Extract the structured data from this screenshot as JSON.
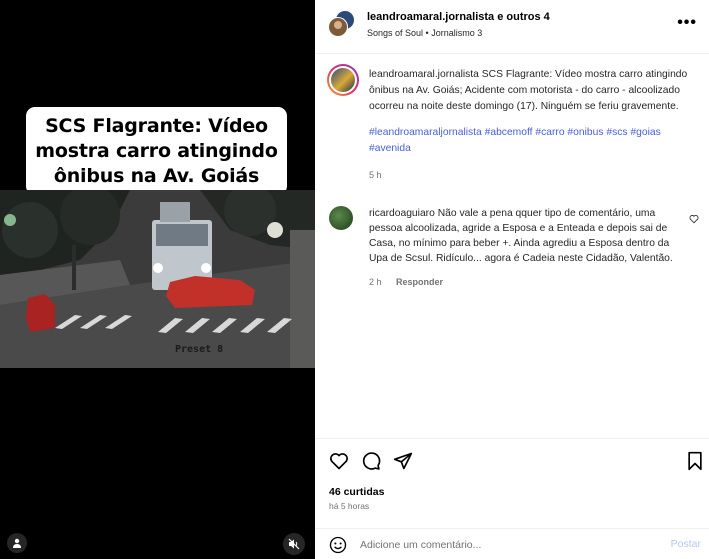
{
  "media": {
    "banner_text": "SCS Flagrante: Vídeo\nmostra carro atingindo\nônibus na Av. Goiás",
    "cctv_label": "Preset 8",
    "user_tag_icon": "user-icon",
    "mute_icon": "speaker-muted-icon"
  },
  "header": {
    "author": "leandroamaral.jornalista e outros 4",
    "subtitle": "Songs of Soul • Jornalismo 3",
    "more_icon": "more-options-icon"
  },
  "caption": {
    "username": "leandroamaral.jornalista",
    "text": "SCS Flagrante: Vídeo mostra carro atingindo ônibus na Av. Goiás; Acidente com motorista - do carro - alcoolizado ocorreu na noite deste domingo (17). Ninguém se feriu gravemente.",
    "hashtags": "#leandroamaraljornalista #abcemoff #carro #onibus #scs #goias #avenida",
    "time": "5 h"
  },
  "comment": {
    "username": "ricardoaguiaro",
    "text": "Não vale a pena qquer tipo de comentário, uma pessoa alcoolizada, agride a Esposa e a Enteada e depois sai de Casa, no mínimo para beber +. Ainda agrediu a Esposa dentro da Upa de Scsul. Ridículo... agora é Cadeia neste Cidadão, Valentão.",
    "time": "2 h",
    "reply_label": "Responder"
  },
  "actions": {
    "likes": "46 curtidas",
    "time_ago": "há 5 horas"
  },
  "add_comment": {
    "placeholder": "Adicione um comentário...",
    "post_label": "Postar"
  },
  "colors": {
    "hashtag": "#4a5ed4",
    "post_disabled": "#b3c9f2",
    "muted_text": "#737373"
  }
}
